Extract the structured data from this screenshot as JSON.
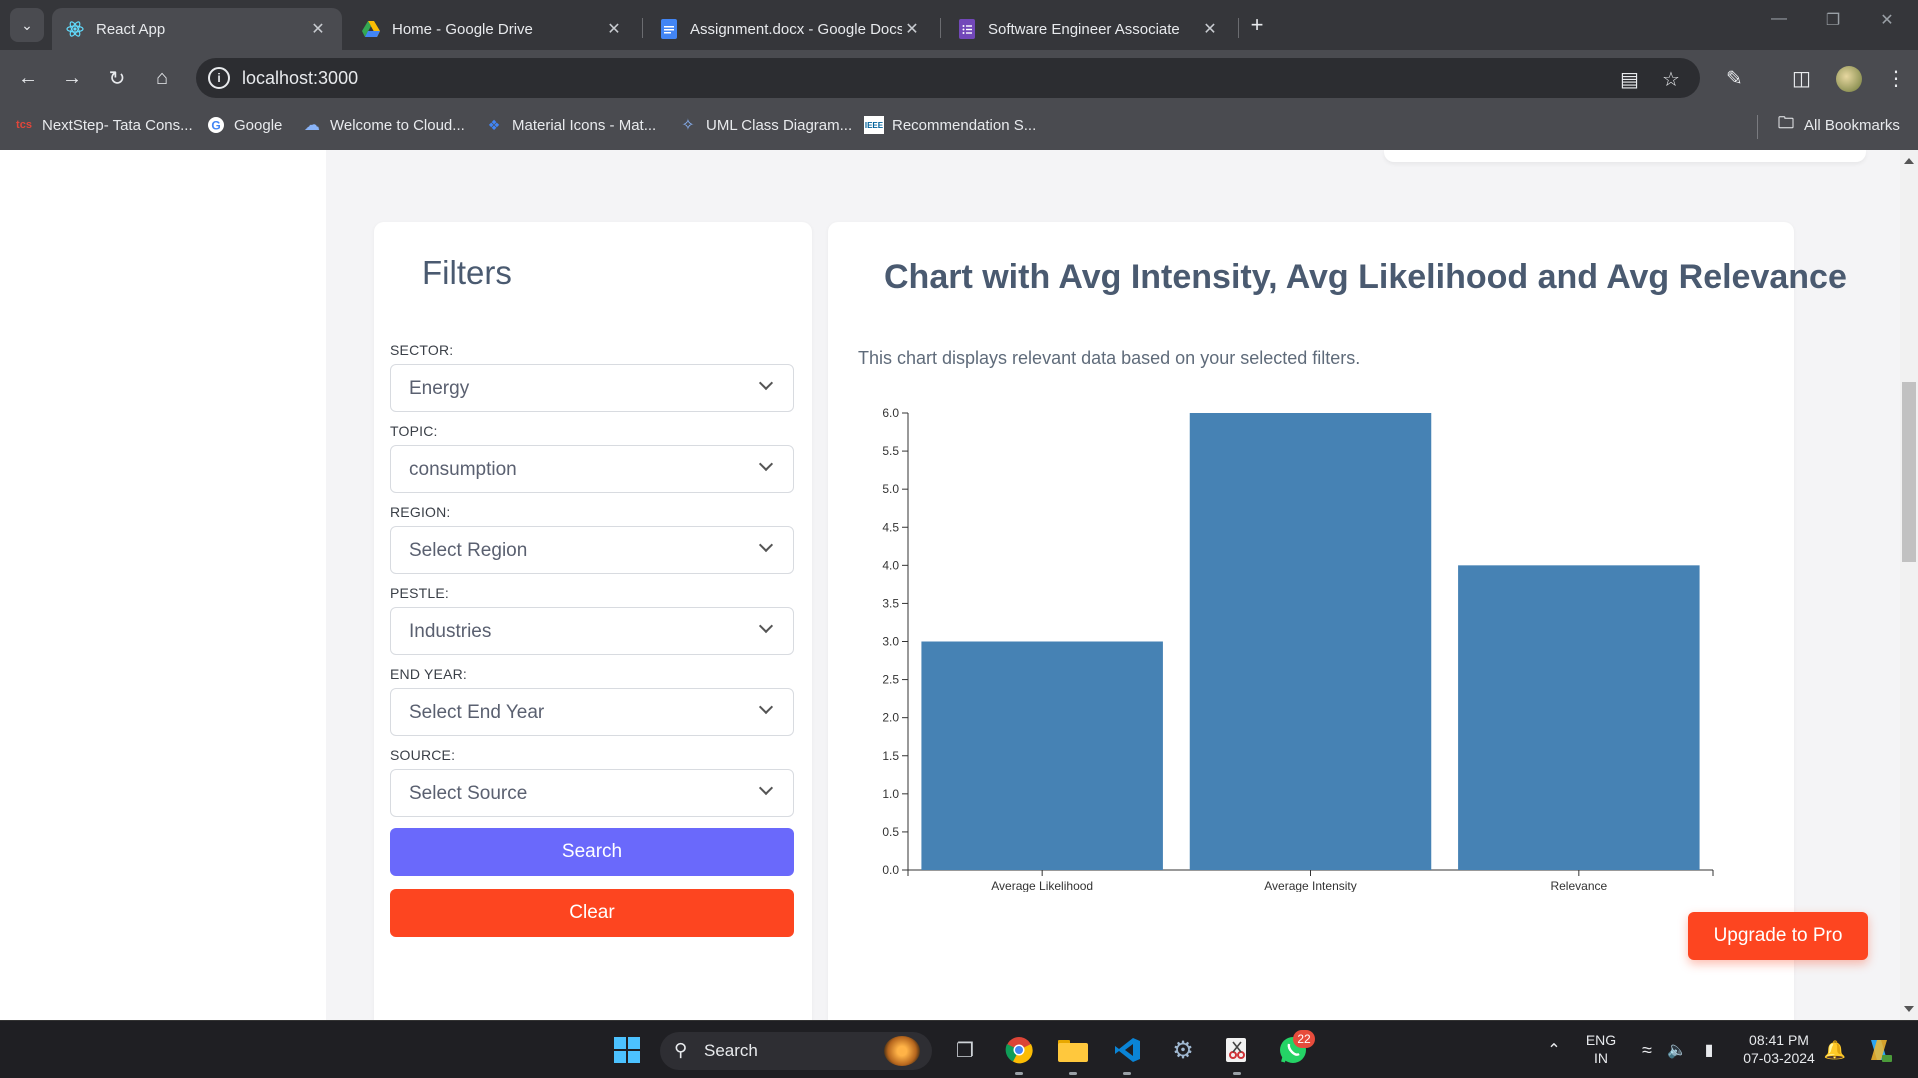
{
  "browser": {
    "tabs": [
      {
        "title": "React App",
        "active": true,
        "icon": "react-icon"
      },
      {
        "title": "Home - Google Drive",
        "active": false,
        "icon": "google-drive-icon"
      },
      {
        "title": "Assignment.docx - Google Docs",
        "active": false,
        "icon": "google-docs-icon"
      },
      {
        "title": "Software Engineer Associate",
        "active": false,
        "icon": "google-forms-icon"
      }
    ],
    "url": "localhost:3000",
    "bookmarks": [
      {
        "label": "NextStep- Tata Cons...",
        "icon": "tcs-icon"
      },
      {
        "label": "Google",
        "icon": "google-icon"
      },
      {
        "label": "Welcome to Cloud...",
        "icon": "cloud-icon"
      },
      {
        "label": "Material Icons - Mat...",
        "icon": "material-icons-icon"
      },
      {
        "label": "UML Class Diagram...",
        "icon": "uml-icon"
      },
      {
        "label": "Recommendation S...",
        "icon": "ieee-icon"
      }
    ],
    "all_bookmarks": "All Bookmarks"
  },
  "filters": {
    "title": "Filters",
    "fields": [
      {
        "label": "SECTOR:",
        "value": "Energy"
      },
      {
        "label": "TOPIC:",
        "value": "consumption"
      },
      {
        "label": "REGION:",
        "value": "Select Region"
      },
      {
        "label": "PESTLE:",
        "value": "Industries"
      },
      {
        "label": "END YEAR:",
        "value": "Select End Year"
      },
      {
        "label": "SOURCE:",
        "value": "Select Source"
      }
    ],
    "search_label": "Search",
    "clear_label": "Clear"
  },
  "chart_panel": {
    "title": "Chart with Avg Intensity, Avg Likelihood and Avg Relevance",
    "description": "This chart displays relevant data based on your selected filters."
  },
  "chart_data": {
    "type": "bar",
    "categories": [
      "Average Likelihood",
      "Average Intensity",
      "Relevance"
    ],
    "values": [
      3,
      6,
      4
    ],
    "ylim": [
      0,
      6
    ],
    "yticks": [
      "0.0",
      "0.5",
      "1.0",
      "1.5",
      "2.0",
      "2.5",
      "3.0",
      "3.5",
      "4.0",
      "4.5",
      "5.0",
      "5.5",
      "6.0"
    ],
    "bar_color": "#4682b4",
    "grid": false
  },
  "upgrade_label": "Upgrade to Pro",
  "taskbar": {
    "search_placeholder": "Search",
    "language": "ENG",
    "region": "IN",
    "time": "08:41 PM",
    "date": "07-03-2024",
    "whatsapp_badge": "22"
  },
  "colors": {
    "primary_button": "#6a69fb",
    "danger_button": "#fd4520",
    "heading": "#4a5a70"
  }
}
